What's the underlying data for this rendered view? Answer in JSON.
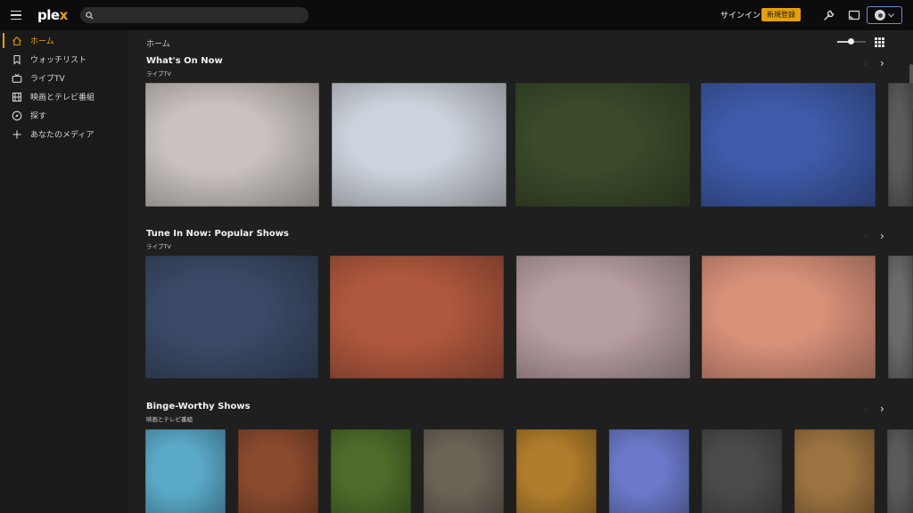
{
  "app": {
    "logo_main": "ple",
    "logo_accent": "x",
    "search_placeholder": "",
    "signin_label": "サインイン",
    "signup_label": "新規登録",
    "icons": [
      "menu-icon",
      "search-icon",
      "settings-wrench-icon",
      "cast-icon",
      "user-avatar-icon",
      "chevron-down-icon"
    ]
  },
  "sidebar": {
    "items": [
      {
        "label": "ホーム",
        "icon": "home-icon",
        "active": true
      },
      {
        "label": "ウォッチリスト",
        "icon": "bookmark-icon",
        "active": false
      },
      {
        "label": "ライブTV",
        "icon": "tv-icon",
        "active": false
      },
      {
        "label": "映画とテレビ番組",
        "icon": "film-icon",
        "active": false
      },
      {
        "label": "探す",
        "icon": "compass-icon",
        "active": false
      },
      {
        "label": "あなたのメディア",
        "icon": "plus-icon",
        "active": false
      }
    ]
  },
  "main": {
    "breadcrumb": "ホーム",
    "sections": [
      {
        "title": "What's On Now",
        "subtitle": "ライブTV",
        "cards": [
          "#c9c2be",
          "#cdd3dc",
          "#3a4a2a",
          "#3e5aa8",
          "#5a5a5a"
        ]
      },
      {
        "title": "Tune In Now: Popular Shows",
        "subtitle": "ライブTV",
        "cards": [
          "#3a4a66",
          "#b0583e",
          "#b79ea2",
          "#d9917a",
          "#6a6a6a"
        ]
      },
      {
        "title": "Binge-Worthy Shows",
        "subtitle": "映画とテレビ番組",
        "cards": [
          "#5aa9c8",
          "#8a4a2e",
          "#4d6b2a",
          "#6b6356",
          "#b07d2c",
          "#6a79c9",
          "#4a4a4a",
          "#9b7340",
          "#5a5a5a"
        ]
      }
    ]
  },
  "colors": {
    "accent": "#e5a00d",
    "topbar_bg": "#0c0c0c",
    "sidebar_bg": "#1a1a1a",
    "main_bg": "#1f1f1f"
  }
}
